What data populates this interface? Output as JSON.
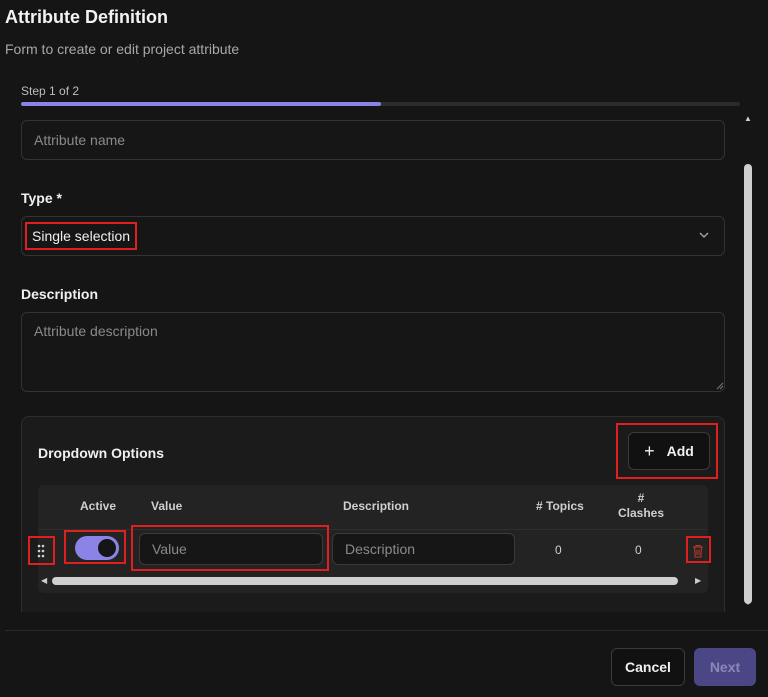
{
  "header": {
    "title": "Attribute Definition",
    "subtitle": "Form to create or edit project attribute"
  },
  "stepper": {
    "label": "Step 1 of 2",
    "progress": 0.5,
    "accent": "#8b84e6"
  },
  "form": {
    "name_placeholder": "Attribute name",
    "type_label": "Type *",
    "type_value": "Single selection",
    "description_label": "Description",
    "description_placeholder": "Attribute description"
  },
  "options": {
    "title": "Dropdown Options",
    "add_label": "Add",
    "columns": {
      "active": "Active",
      "value": "Value",
      "description": "Description",
      "topics": "# Topics",
      "clashes_hash": "#",
      "clashes": "Clashes"
    },
    "rows": [
      {
        "active": true,
        "value_placeholder": "Value",
        "description_placeholder": "Description",
        "topics": "0",
        "clashes": "0"
      }
    ]
  },
  "footer": {
    "cancel_label": "Cancel",
    "next_label": "Next"
  },
  "colors": {
    "background": "#151515",
    "highlight": "#e02020",
    "next_disabled": "#4b4787"
  }
}
